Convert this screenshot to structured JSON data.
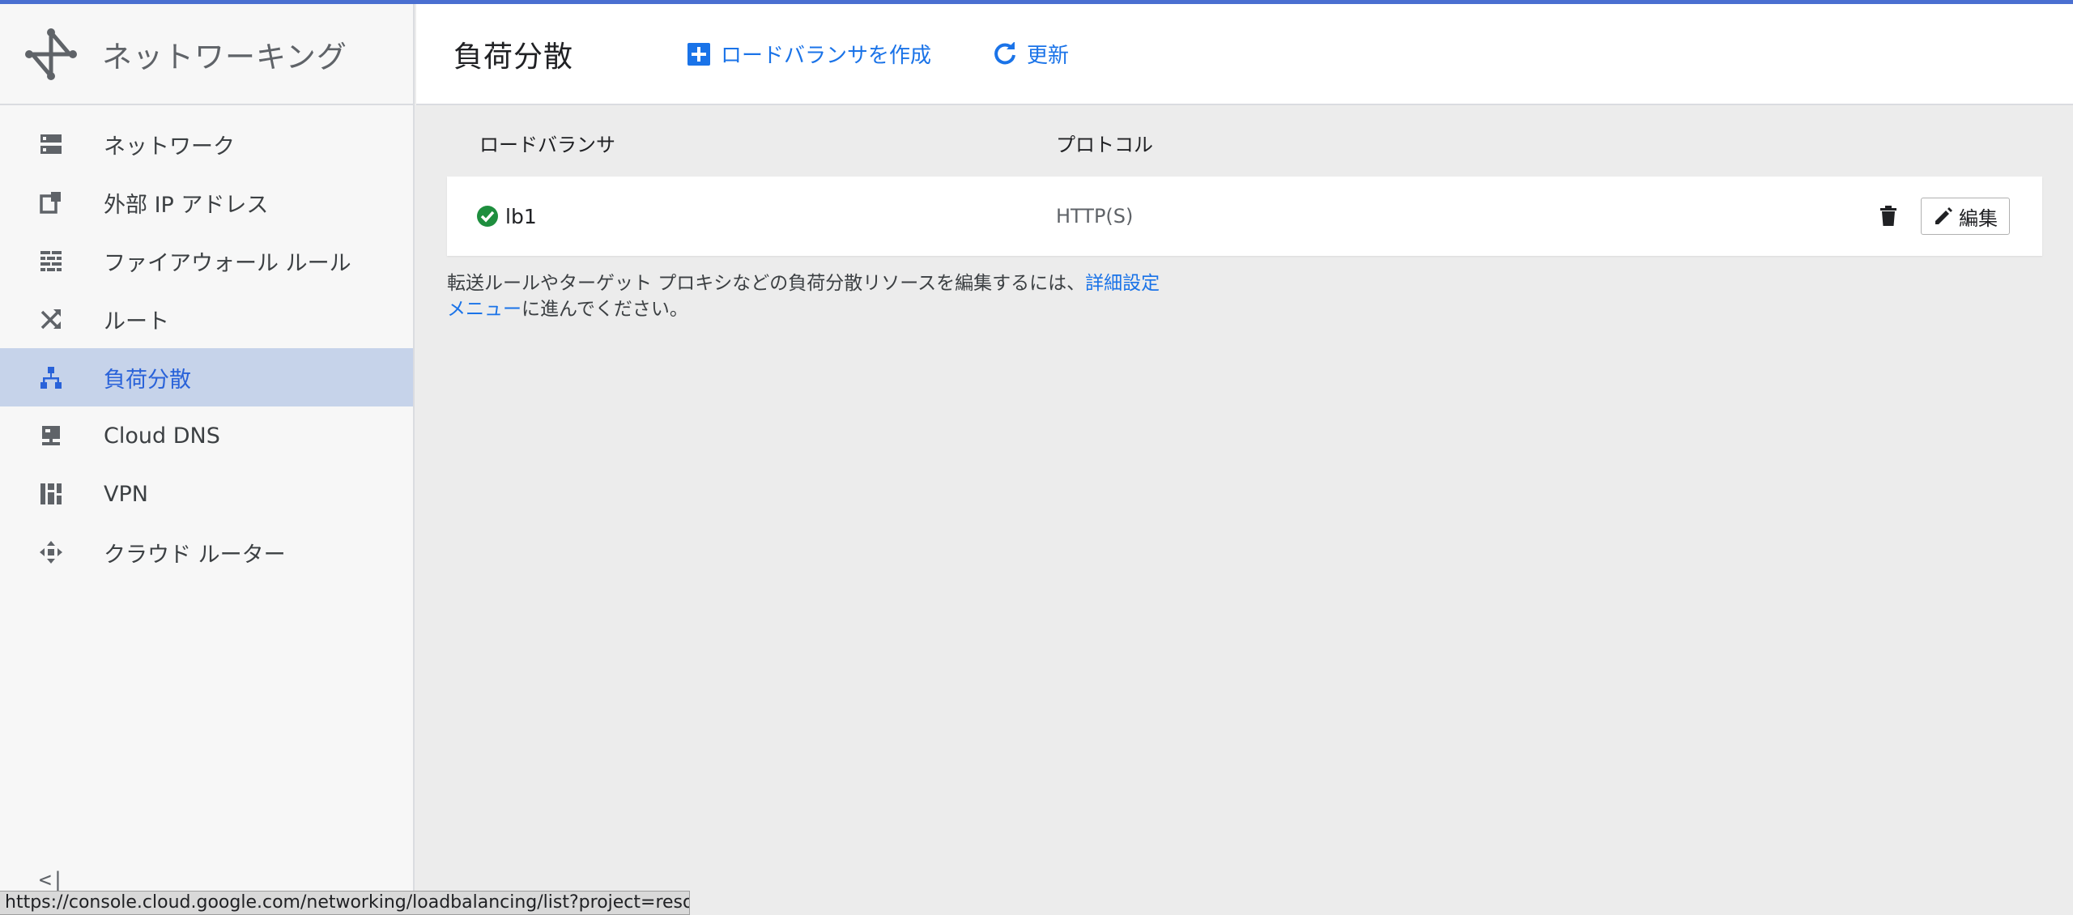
{
  "sidebar": {
    "title": "ネットワーキング",
    "items": [
      {
        "label": "ネットワーク",
        "icon": "network-icon"
      },
      {
        "label": "外部 IP アドレス",
        "icon": "external-ip-icon"
      },
      {
        "label": "ファイアウォール ルール",
        "icon": "firewall-icon"
      },
      {
        "label": "ルート",
        "icon": "route-icon"
      },
      {
        "label": "負荷分散",
        "icon": "load-balancing-icon",
        "active": true
      },
      {
        "label": "Cloud DNS",
        "icon": "dns-icon"
      },
      {
        "label": "VPN",
        "icon": "vpn-icon"
      },
      {
        "label": "クラウド ルーター",
        "icon": "router-icon"
      }
    ],
    "collapse_label": "<|"
  },
  "header": {
    "title": "負荷分散",
    "create_label": "ロードバランサを作成",
    "refresh_label": "更新"
  },
  "table": {
    "columns": [
      "ロードバランサ",
      "プロトコル"
    ],
    "rows": [
      {
        "name": "lb1",
        "protocol": "HTTP(S)",
        "status": "ok"
      }
    ],
    "edit_label": "編集"
  },
  "note": {
    "text_before": "転送ルールやターゲット プロキシなどの負荷分散リソースを編集するには、",
    "link": "詳細設定メニュー",
    "text_after": "に進んでください。"
  },
  "statusbar": {
    "url": "https://console.cloud.google.com/networking/loadbalancing/list?project=resolut"
  },
  "colors": {
    "accent": "#1a73e8",
    "active_bg": "#c6d3ea",
    "status_ok": "#1e8e3e",
    "top_bar": "#4a6fd1"
  }
}
